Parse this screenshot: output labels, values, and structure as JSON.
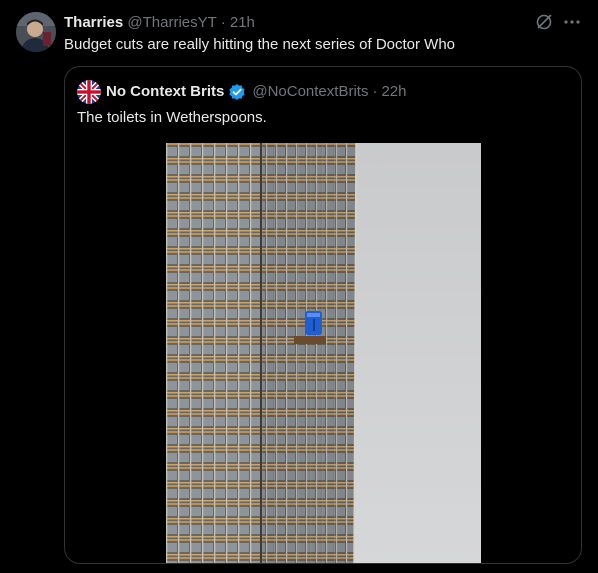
{
  "tweet": {
    "author_name": "Tharries",
    "author_handle": "@TharriesYT",
    "separator": "·",
    "time": "21h",
    "text": "Budget cuts are really hitting the next series of Doctor Who"
  },
  "icons": {
    "grok": "grok-icon",
    "more": "more-icon",
    "verified": "verified-badge-icon",
    "flag": "union-jack-icon"
  },
  "quoted": {
    "author_name": "No Context Brits",
    "author_handle": "@NoContextBrits",
    "separator": "·",
    "time": "22h",
    "text": "The toilets in Wetherspoons."
  },
  "colors": {
    "background": "#000000",
    "text": "#e7e9ea",
    "muted": "#71767b",
    "border": "#2f3336",
    "verified": "#1d9bf0",
    "portaloo": "#1f5fd1"
  }
}
